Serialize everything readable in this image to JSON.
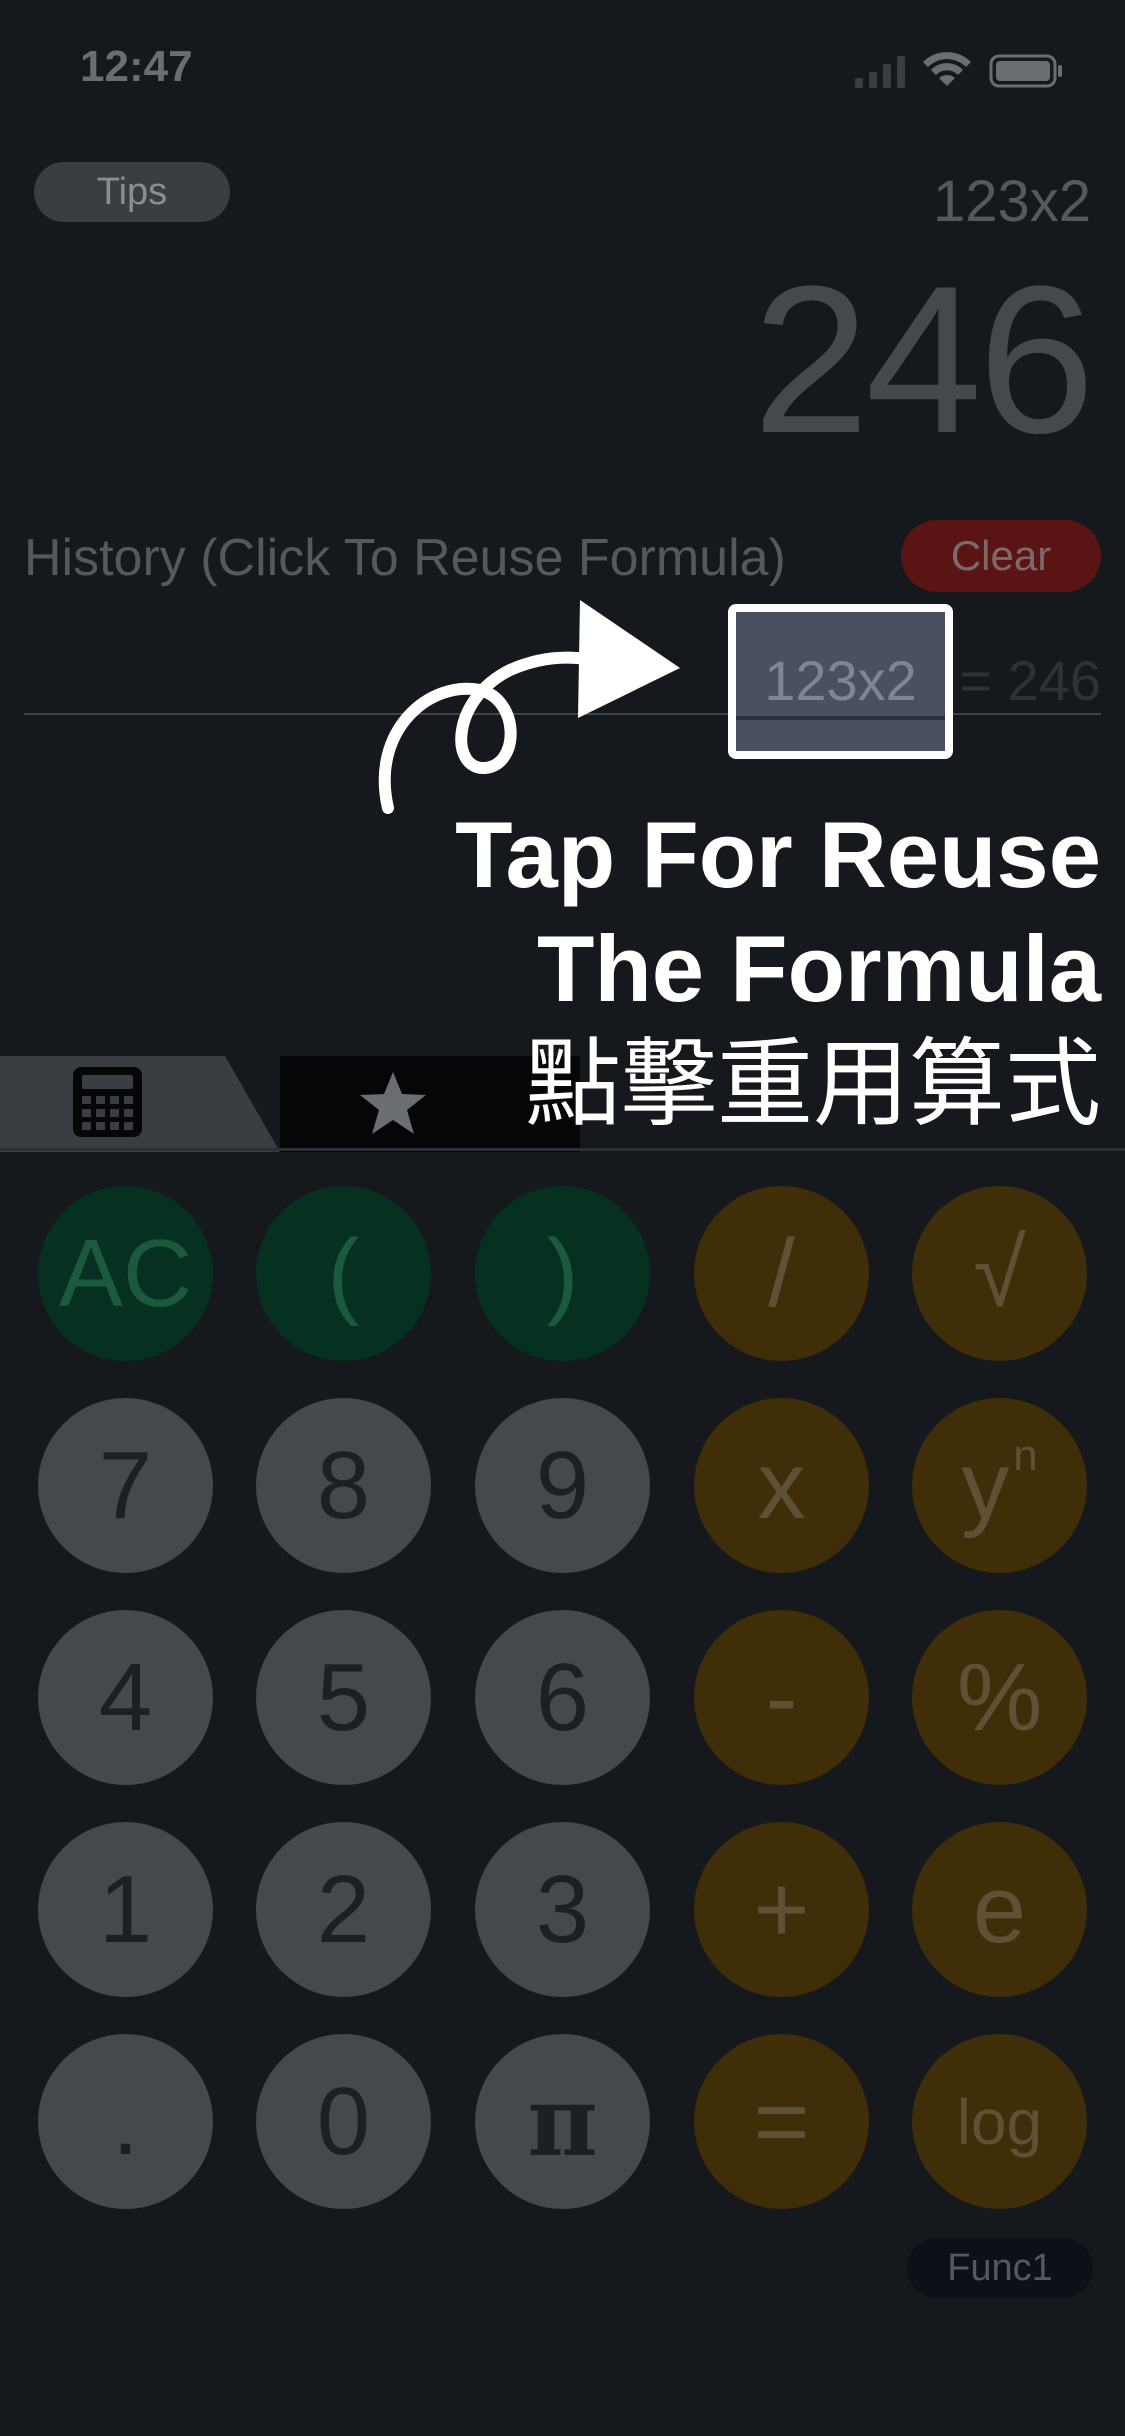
{
  "status_bar": {
    "time": "12:47"
  },
  "header": {
    "tips_label": "Tips"
  },
  "display": {
    "expression": "123x2",
    "result": "246"
  },
  "history": {
    "title": "History (Click To Reuse Formula)",
    "clear_label": "Clear",
    "rows": [
      {
        "formula": "123x2",
        "equals": "= 246"
      }
    ]
  },
  "tabs": [
    {
      "icon": "calculator-icon",
      "active": true
    },
    {
      "icon": "star-icon",
      "active": false
    }
  ],
  "overlay": {
    "line1": "Tap For Reuse",
    "line2": "The Formula",
    "line3": "點擊重用算式"
  },
  "keypad": {
    "rows": [
      [
        "AC",
        "(",
        ")",
        "/",
        "√"
      ],
      [
        "7",
        "8",
        "9",
        "x",
        "y"
      ],
      [
        "4",
        "5",
        "6",
        "-",
        "%"
      ],
      [
        "1",
        "2",
        "3",
        "+",
        "e"
      ],
      [
        ".",
        "0",
        "π",
        "=",
        "log"
      ]
    ],
    "yn_sup": "n"
  },
  "footer": {
    "func_label": "Func1"
  },
  "colors": {
    "background": "#15181c",
    "green_key": "#06301f",
    "gray_key": "#45484c",
    "orange_key": "#3f2e08",
    "clear_button": "#5a1414",
    "overlay_text": "#ffffff"
  }
}
